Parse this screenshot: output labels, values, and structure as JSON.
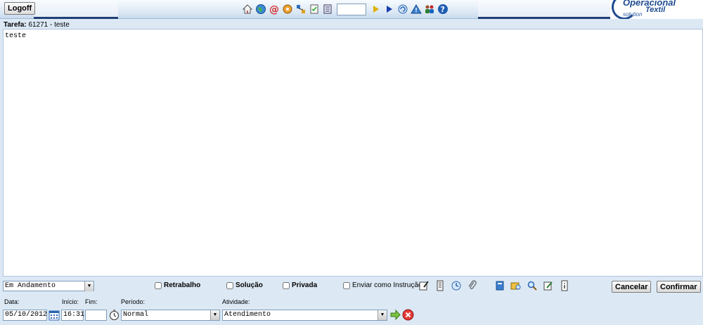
{
  "header": {
    "logoff_label": "Logoff",
    "logo": {
      "line1": "Operacional",
      "line2": "Textil",
      "line3": "solution"
    },
    "toolbar_icons": [
      "home-icon",
      "globe-icon",
      "email-icon",
      "tools-icon",
      "network-icon",
      "checklist-icon",
      "document-icon"
    ],
    "toolbar_after_icons": [
      "play-icon",
      "play-next-icon",
      "refresh-icon",
      "warning-icon",
      "people-icon",
      "help-icon"
    ],
    "toolbar_input_value": ""
  },
  "task": {
    "label": "Tarefa:",
    "number": "61271",
    "title": " - teste"
  },
  "editor": {
    "content": "teste"
  },
  "controls": {
    "status_value": "Em Andamento",
    "checkboxes": [
      {
        "label": "Retrabalho",
        "checked": false
      },
      {
        "label": "Solução",
        "checked": false
      },
      {
        "label": "Privada",
        "checked": false
      },
      {
        "label": "Enviar como Instrução",
        "checked": false
      }
    ],
    "action_icons": [
      "edit-note-icon",
      "script-icon",
      "history-icon",
      "attach-icon",
      "book-icon",
      "search-folder-icon",
      "magnifier-icon",
      "pencil-icon",
      "info-icon"
    ],
    "cancel_label": "Cancelar",
    "confirm_label": "Confirmar"
  },
  "form": {
    "date_label": "Data:",
    "date_value": "05/10/2012",
    "start_label": "Início:",
    "start_value": "16:31",
    "end_label": "Fim:",
    "end_value": "",
    "period_label": "Período:",
    "period_value": "Normal",
    "activity_label": "Atividade:",
    "activity_value": "Atendimento"
  }
}
